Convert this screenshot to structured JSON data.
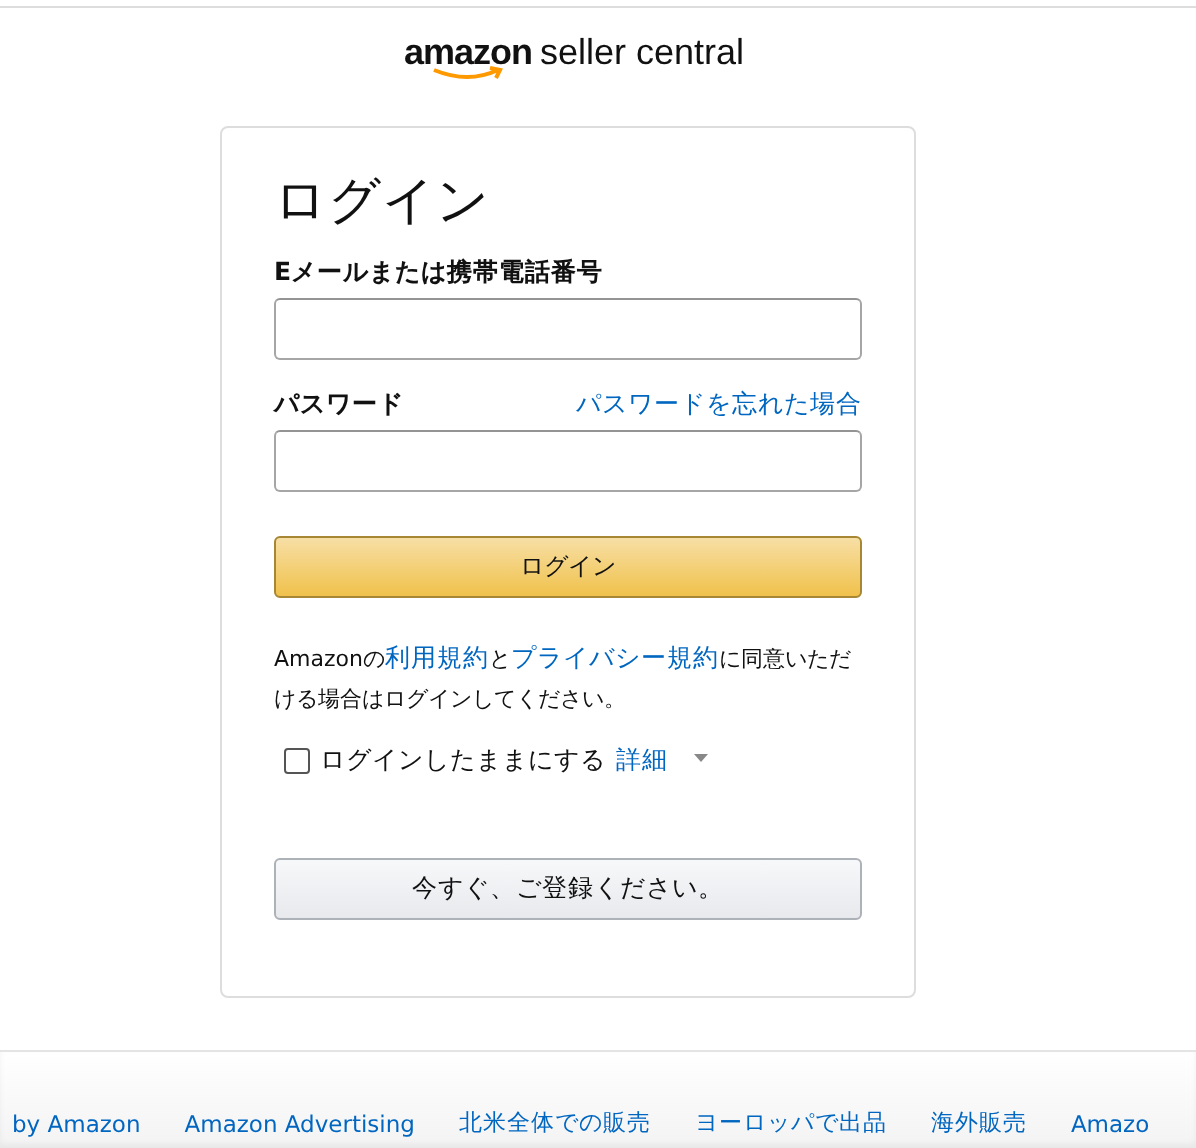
{
  "logo": {
    "brand": "amazon",
    "product": "seller central"
  },
  "login": {
    "title": "ログイン",
    "email": {
      "label": "Eメールまたは携帯電話番号"
    },
    "password": {
      "label": "パスワード",
      "forgot_link": "パスワードを忘れた場合"
    },
    "submit": "ログイン",
    "terms": [
      {
        "kind": "text",
        "text": "Amazonの"
      },
      {
        "kind": "link",
        "text": "利用規約"
      },
      {
        "kind": "text",
        "text": "と"
      },
      {
        "kind": "link",
        "text": "プライバシー規約"
      },
      {
        "kind": "text",
        "text": "に同意いただける場合はログインしてください。"
      }
    ],
    "keep_signed_in": {
      "label": "ログインしたままにする",
      "checked": false,
      "details_link": "詳細"
    },
    "register": "今すぐ、ご登録ください。"
  },
  "footer_links": [
    "by Amazon",
    "Amazon Advertising",
    "北米全体での販売",
    "ヨーロッパで出品",
    "海外販売",
    "Amazo"
  ]
}
